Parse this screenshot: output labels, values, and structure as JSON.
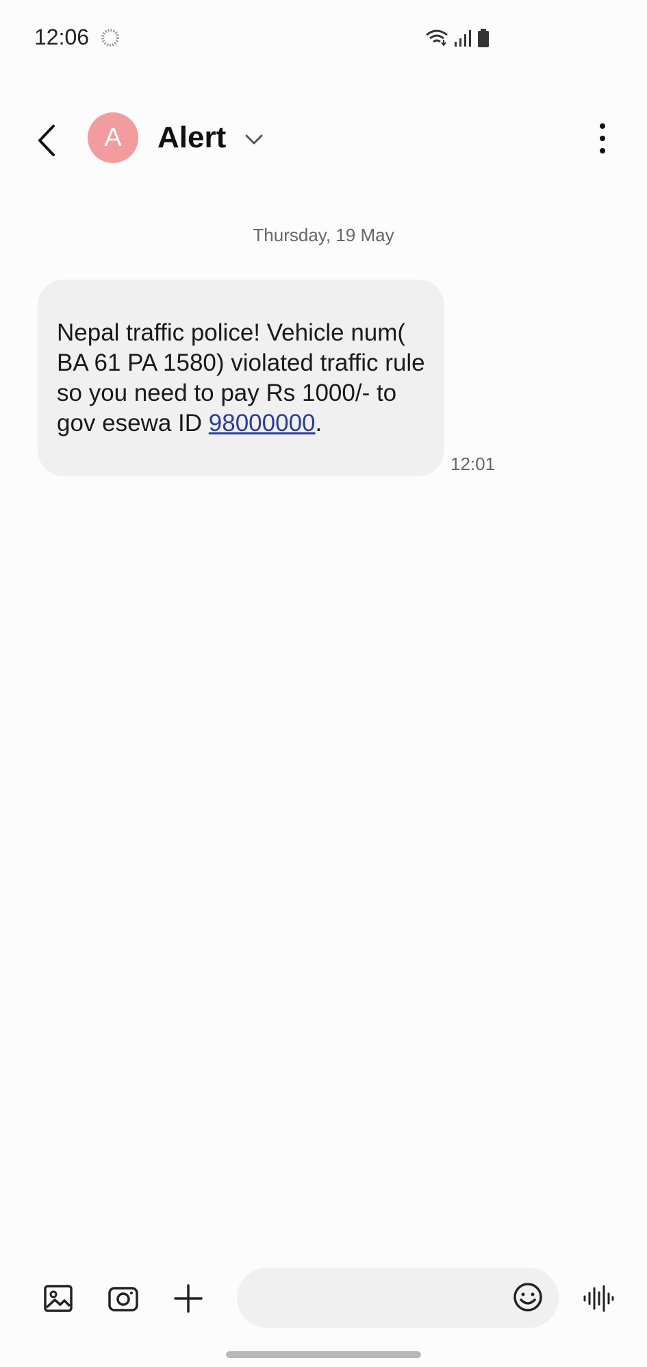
{
  "status_bar": {
    "time": "12:06",
    "icons": [
      "sync-icon",
      "wifi-icon",
      "signal-icon",
      "battery-icon"
    ]
  },
  "header": {
    "back_icon": "chevron-left-icon",
    "avatar_letter": "A",
    "avatar_color": "#f29ca0",
    "contact_name": "Alert",
    "dropdown_icon": "chevron-down-icon",
    "more_icon": "more-vertical-icon"
  },
  "conversation": {
    "date_separator": "Thursday, 19 May",
    "messages": [
      {
        "text_before_link": "Nepal traffic police! Vehicle num( BA 61 PA 1580) violated traffic rule so you need to pay Rs 1000/-  to gov esewa ID ",
        "link_text": "98000000",
        "text_after_link": ".",
        "time": "12:01",
        "direction": "incoming"
      }
    ]
  },
  "composer": {
    "gallery_icon": "gallery-icon",
    "camera_icon": "camera-icon",
    "add_icon": "add-icon",
    "input_value": "",
    "emoji_icon": "emoji-icon",
    "voice_icon": "voice-wave-icon"
  },
  "colors": {
    "background": "#fcfcfc",
    "bubble": "#f0f0f0",
    "link": "#2a3d9a",
    "avatar": "#f29ca0"
  }
}
